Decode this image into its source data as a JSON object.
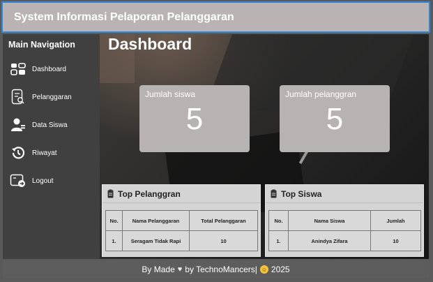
{
  "header": {
    "title": "System Informasi Pelaporan Pelanggaran"
  },
  "sidebar": {
    "title": "Main Navigation",
    "items": [
      {
        "label": "Dashboard",
        "icon": "dashboard-icon"
      },
      {
        "label": "Pelanggaran",
        "icon": "document-search-icon"
      },
      {
        "label": "Data Siswa",
        "icon": "user-icon"
      },
      {
        "label": "Riwayat",
        "icon": "history-icon"
      },
      {
        "label": "Logout",
        "icon": "logout-icon"
      }
    ]
  },
  "main": {
    "title": "Dashboard",
    "stats": [
      {
        "label": "Jumlah siswa",
        "value": "5"
      },
      {
        "label": "Jumlah pelanggran",
        "value": "5"
      }
    ],
    "top_pelanggaran": {
      "title": "Top Pelanggran",
      "headers": [
        "No.",
        "Nama Pelanggaran",
        "Total Pelanggaran"
      ],
      "rows": [
        [
          "1.",
          "Seragam Tidak Rapi",
          "10"
        ]
      ]
    },
    "top_siswa": {
      "title": "Top Siswa",
      "headers": [
        "No.",
        "Nama Siswa",
        "Jumlah"
      ],
      "rows": [
        [
          "1.",
          "Anindya Zifara",
          "10"
        ]
      ]
    }
  },
  "footer": {
    "before": "By Made",
    "after": "by TechnoMancers|",
    "year": "2025"
  },
  "colors": {
    "header_bg": "#bab3b3",
    "header_border": "#2f86d6",
    "sidebar_bg": "#404040",
    "card_bg": "#b8b3b3"
  }
}
